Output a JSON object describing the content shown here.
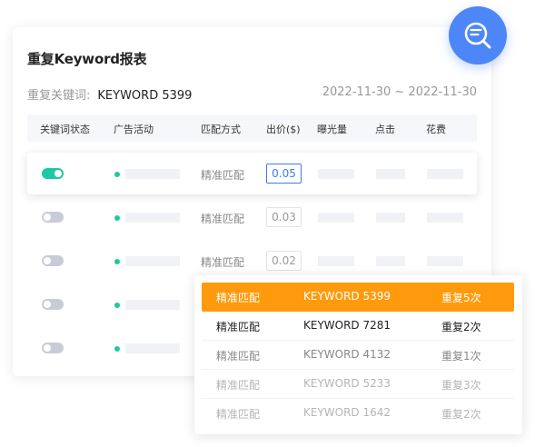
{
  "report": {
    "title": "重复Keyword报表",
    "keyword_label": "重复关键词:",
    "keyword_value": "KEYWORD 5399",
    "date_range": "2022-11-30 ~ 2022-11-30"
  },
  "table": {
    "headers": [
      "关键词状态",
      "广告活动",
      "匹配方式",
      "出价($)",
      "曝光量",
      "点击",
      "花费"
    ],
    "rows": [
      {
        "enabled": true,
        "match": "精准匹配",
        "bid": "0.05",
        "selected": true
      },
      {
        "enabled": false,
        "match": "精准匹配",
        "bid": "0.03",
        "selected": false
      },
      {
        "enabled": false,
        "match": "精准匹配",
        "bid": "0.02",
        "selected": false
      },
      {
        "enabled": false,
        "match": "",
        "bid": "",
        "selected": false
      },
      {
        "enabled": false,
        "match": "",
        "bid": "",
        "selected": false
      }
    ]
  },
  "dropdown": {
    "items": [
      {
        "match": "精准匹配",
        "keyword": "KEYWORD 5399",
        "repeat": "重复5次",
        "highlighted": true
      },
      {
        "match": "精准匹配",
        "keyword": "KEYWORD 7281",
        "repeat": "重复2次"
      },
      {
        "match": "精准匹配",
        "keyword": "KEYWORD 4132",
        "repeat": "重复1次"
      },
      {
        "match": "精准匹配",
        "keyword": "KEYWORD 5233",
        "repeat": "重复3次"
      },
      {
        "match": "精准匹配",
        "keyword": "KEYWORD 1642",
        "repeat": "重复2次"
      }
    ]
  },
  "colors": {
    "accent_blue": "#4d86f7",
    "toggle_on": "#1dc9a4",
    "highlight_orange": "#ff9a0c"
  },
  "icons": {
    "floating_button": "search-list-icon"
  }
}
